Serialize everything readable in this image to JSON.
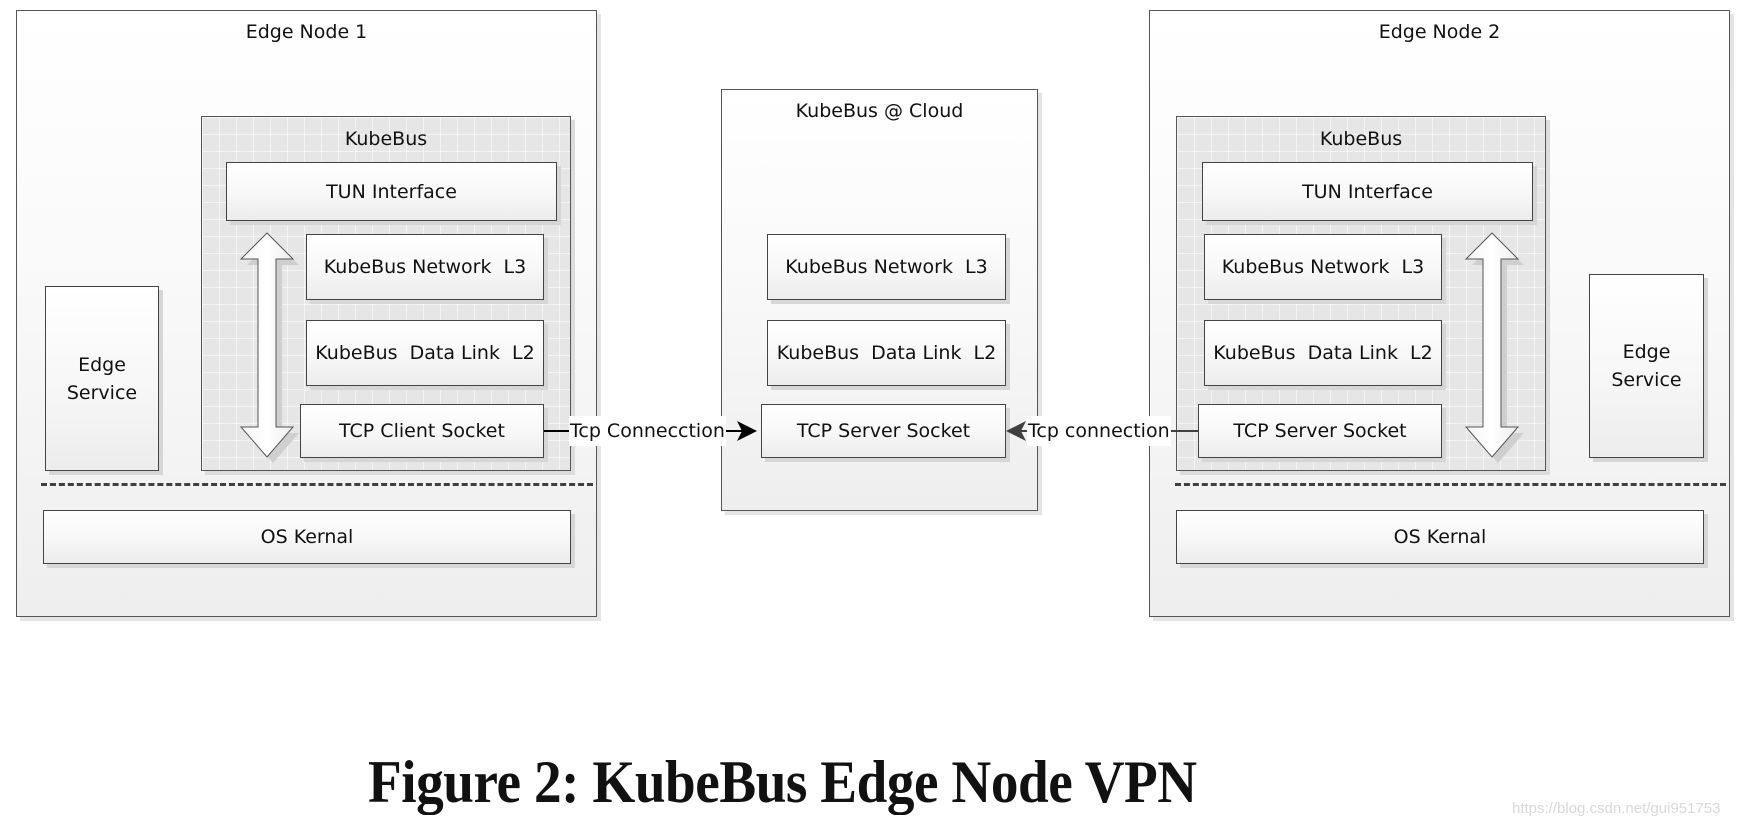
{
  "figure": {
    "caption": "Figure 2: KubeBus Edge Node VPN",
    "watermark": "https://blog.csdn.net/gui951753"
  },
  "edge_node_1": {
    "title": "Edge Node 1",
    "edge_service": "Edge\nService",
    "kubebus": {
      "title": "KubeBus",
      "tun": "TUN Interface",
      "network": "KubeBus Network  L3",
      "datalink": "KubeBus  Data Link  L2",
      "socket": "TCP Client Socket"
    },
    "os_kernel": "OS Kernal"
  },
  "cloud": {
    "title": "KubeBus @ Cloud",
    "network": "KubeBus Network  L3",
    "datalink": "KubeBus  Data Link  L2",
    "socket": "TCP Server Socket"
  },
  "edge_node_2": {
    "title": "Edge Node 2",
    "edge_service": "Edge\nService",
    "kubebus": {
      "title": "KubeBus",
      "tun": "TUN Interface",
      "network": "KubeBus Network  L3",
      "datalink": "KubeBus  Data Link  L2",
      "socket": "TCP Server Socket"
    },
    "os_kernel": "OS Kernal"
  },
  "connections": [
    {
      "label": "Tcp Connecction",
      "from": "TCP Client Socket (Edge Node 1)",
      "to": "TCP Server Socket (Cloud)",
      "color": "#000000"
    },
    {
      "label": "Tcp connection",
      "from": "TCP Server Socket (Edge Node 2)",
      "to": "TCP Server Socket (Cloud)",
      "color": "#404040"
    }
  ]
}
